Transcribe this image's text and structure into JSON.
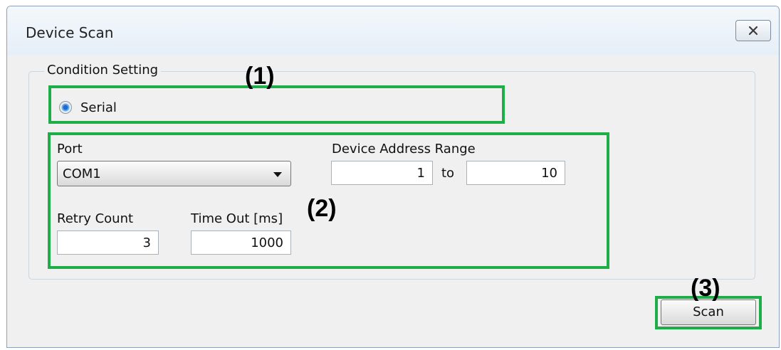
{
  "window": {
    "title": "Device Scan",
    "close_icon": "close-x-icon"
  },
  "condition": {
    "group_label": "Condition Setting",
    "serial_label": "Serial",
    "serial_selected": true
  },
  "port": {
    "label": "Port",
    "value": "COM1"
  },
  "address_range": {
    "label": "Device Address Range",
    "from": "1",
    "to_label": "to",
    "to": "10"
  },
  "retry": {
    "label": "Retry Count",
    "value": "3"
  },
  "timeout": {
    "label": "Time Out [ms]",
    "value": "1000"
  },
  "scan_button": {
    "label": "Scan"
  },
  "annotations": {
    "callout_1": "(1)",
    "callout_2": "(2)",
    "callout_3": "(3)",
    "highlight_color": "#1fad4a"
  }
}
